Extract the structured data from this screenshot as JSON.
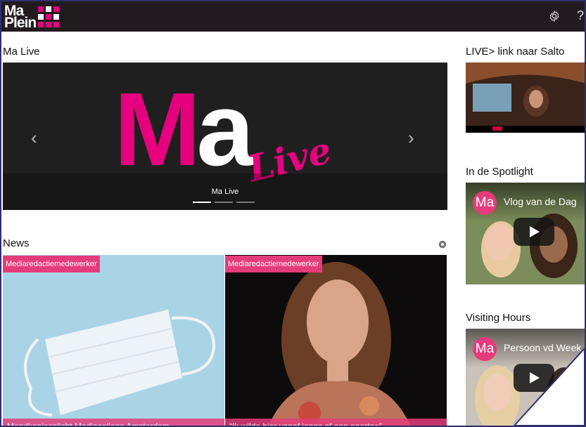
{
  "header": {
    "logo_line1": "Ma",
    "logo_line2": "Plein",
    "help_glyph": "?"
  },
  "main": {
    "carousel": {
      "section_title": "Ma Live",
      "slide_ma": "Ma",
      "slide_live": "Live",
      "caption": "Ma Live",
      "prev_glyph": "‹",
      "next_glyph": "›",
      "slide_count": 3,
      "active_slide": 1
    },
    "news": {
      "section_title": "News",
      "items": [
        {
          "tag": "Mediaredactiemedewerker",
          "title": "Mondkapjesplicht Mediacollege Amsterdam"
        },
        {
          "tag": "Mediaredactiemedewerker",
          "title": "“Ik wilde hier vanaf jongs af aan naartoe”"
        }
      ]
    }
  },
  "sidebar": {
    "live": {
      "section_title": "LIVE> link naar Salto"
    },
    "spotlight": {
      "section_title": "In de Spotlight",
      "avatar": "Ma",
      "video_title": "Vlog van de Dag"
    },
    "visiting": {
      "section_title": "Visiting Hours",
      "avatar": "Ma",
      "video_title": "Persoon vd Week"
    }
  },
  "colors": {
    "brand": "#e6007e",
    "tag": "#e43c7a",
    "topbar": "#211b1f"
  },
  "icons": [
    "settings-gear-icon",
    "help-icon",
    "chevron-left-icon",
    "chevron-right-icon",
    "play-icon"
  ]
}
